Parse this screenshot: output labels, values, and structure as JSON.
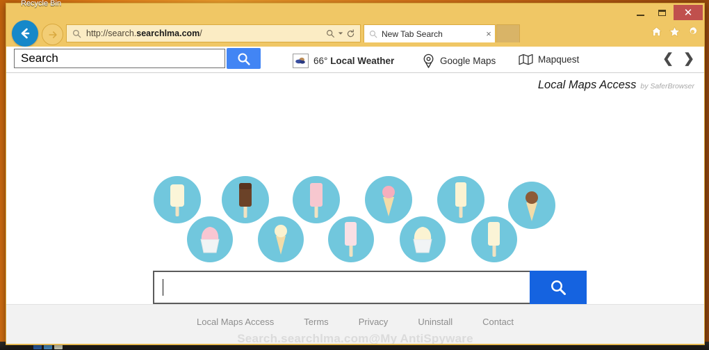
{
  "desktop": {
    "recycle_bin_label": "Recycle Bin"
  },
  "window": {
    "minimize_label": "–",
    "maximize_label": "□",
    "close_label": "✕",
    "back_icon": "back-arrow-icon",
    "forward_icon": "forward-arrow-icon"
  },
  "address_bar": {
    "scheme_path": "http://search.",
    "domain": "searchlma.com",
    "trailing": "/",
    "full_url": "http://search.searchlma.com/",
    "search_icon": "magnifier-icon",
    "dropdown_icon": "chevron-down-icon",
    "reload_icon": "reload-icon"
  },
  "tab": {
    "title": "New Tab Search",
    "icon": "magnifier-icon",
    "close_label": "×"
  },
  "chrome_icons": [
    {
      "name": "home-icon",
      "label": "Home"
    },
    {
      "name": "favorites-star-icon",
      "label": "Favorites"
    },
    {
      "name": "settings-gear-icon",
      "label": "Tools"
    }
  ],
  "toolbar": {
    "search_value": "Search",
    "search_placeholder": "Search",
    "search_button_icon": "magnifier-icon",
    "weather_temp": "66°",
    "weather_label": "Local Weather",
    "weather_icon": "weather-cloud-icon",
    "google_maps_label": "Google Maps",
    "google_maps_icon": "map-pin-icon",
    "mapquest_label": "Mapquest",
    "mapquest_icon": "folded-map-icon",
    "prev_arrow": "❮",
    "next_arrow": "❯"
  },
  "page": {
    "brand_title": "Local Maps Access",
    "brand_subtitle": "by SaferBrowser",
    "search_value": "",
    "search_placeholder": "",
    "search_button_icon": "magnifier-icon",
    "logo_alt": "ice-cream-circles-logo",
    "logo_circle_color": "#71c7dd"
  },
  "footer": {
    "links": [
      {
        "label": "Local Maps Access"
      },
      {
        "label": "Terms"
      },
      {
        "label": "Privacy"
      },
      {
        "label": "Uninstall"
      },
      {
        "label": "Contact"
      }
    ],
    "watermark": "Search.searchlma.com@My AntiSpyware"
  },
  "colors": {
    "chrome_gold": "#f0c765",
    "accent_blue": "#1563e0",
    "toolbar_blue": "#4285f4",
    "close_red": "#c0504d",
    "circle_blue": "#71c7dd"
  }
}
